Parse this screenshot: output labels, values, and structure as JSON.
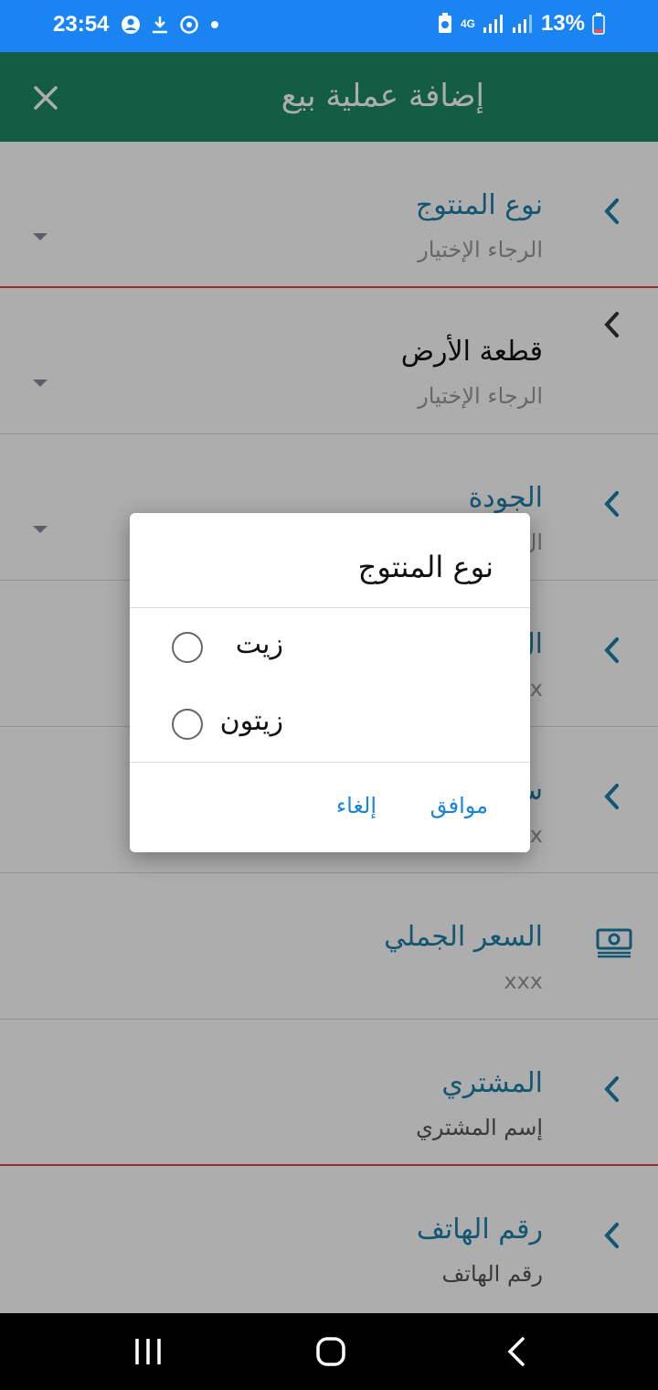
{
  "status_bar": {
    "time": "23:54",
    "network": "4G",
    "battery": "13%",
    "icons_left": [
      "account-icon",
      "download-icon",
      "sync-icon",
      "dot-icon"
    ],
    "icons_right": [
      "battery-saver-icon",
      "network-4g-icon",
      "signal-icon",
      "signal-icon",
      "battery-icon"
    ]
  },
  "app_bar": {
    "title": "إضافة عملية بيع",
    "close_icon": "close-icon"
  },
  "form": {
    "product_type": {
      "label": "نوع المنتوج",
      "placeholder": "الرجاء الإختيار"
    },
    "land_plot": {
      "label": "قطعة الأرض",
      "placeholder": "الرجاء الإختيار"
    },
    "quality": {
      "label": "الجودة",
      "placeholder": "ال"
    },
    "field4": {
      "label": "ال",
      "value": "x"
    },
    "field5": {
      "label": "س",
      "value": "x"
    },
    "total_price": {
      "label": "السعر الجملي",
      "value": "xxx",
      "icon": "cash-icon"
    },
    "buyer": {
      "label": "المشتري",
      "placeholder": "إسم المشتري"
    },
    "phone": {
      "label": "رقم الهاتف",
      "placeholder": "رقم الهاتف"
    }
  },
  "dialog": {
    "title": "نوع المنتوج",
    "options": [
      {
        "label": "زيت",
        "selected": false
      },
      {
        "label": "زيتون",
        "selected": false
      }
    ],
    "ok_label": "موافق",
    "cancel_label": "إلغاء"
  },
  "colors": {
    "status_bar": "#1a84f2",
    "app_bar": "#1e8a66",
    "label_blue": "#1c7fa8",
    "error_red": "#e0434a",
    "button_blue": "#1a84d8"
  }
}
